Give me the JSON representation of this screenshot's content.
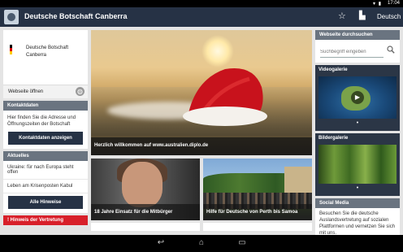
{
  "statusbar": {
    "time": "17:04",
    "icons": "▾ ▮"
  },
  "appbar": {
    "title": "Deutsche Botschaft Canberra",
    "language": "Deutsch"
  },
  "left": {
    "embassy_name": "Deutsche Botschaft Canberra",
    "open_label": "Webseite öffnen",
    "contact": {
      "heading": "Kontaktdaten",
      "text": "Hier finden Sie die Adresse und Öffnungszeiten der Botschaft",
      "button": "Kontaktdaten anzeigen"
    },
    "news": {
      "heading": "Aktuelles",
      "items": [
        "Ukraine: für nach Europa steht offen",
        "Leben am Krisenposten Kabul"
      ],
      "button": "Alle Hinweise"
    },
    "notice_heading": "! Hinweis der Vertretung"
  },
  "center": {
    "hero_caption": "Herzlich willkommen auf www.australien.diplo.de",
    "tiles": [
      {
        "caption": "18 Jahre Einsatz für die Mitbürger"
      },
      {
        "caption": "Hilfe für Deutsche von Perth bis Samoa"
      }
    ]
  },
  "right": {
    "search": {
      "heading": "Webseite durchsuchen",
      "placeholder": "Suchbegriff eingeben"
    },
    "video_gallery": "Videogalerie",
    "image_gallery": "Bildergalerie",
    "social": {
      "heading": "Social Media",
      "text": "Besuchen Sie die deutsche Auslandsvertretung auf sozialen Plattformen und vernetzen Sie sich mit uns."
    }
  },
  "colors": {
    "appbar": "#263245",
    "accent_red": "#d8202a",
    "section_head": "#6a7480"
  }
}
